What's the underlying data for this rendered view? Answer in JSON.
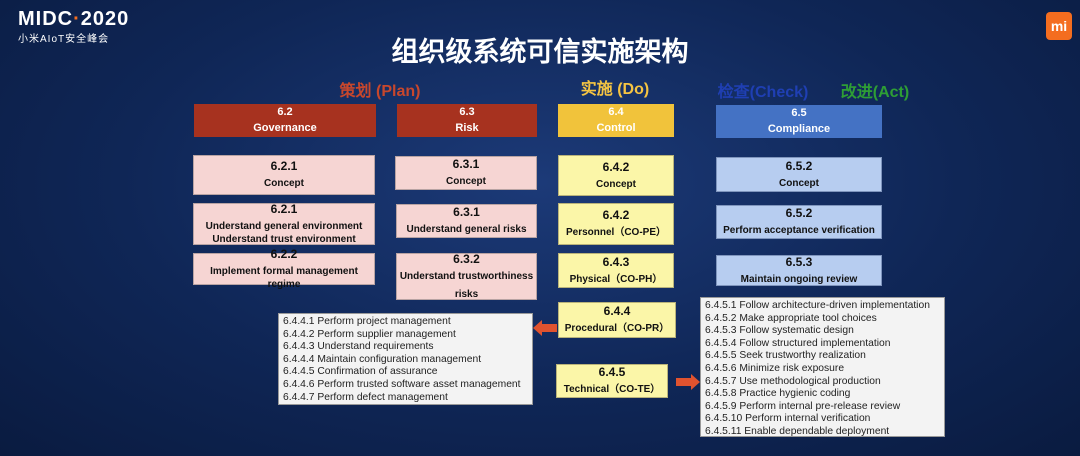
{
  "logo": {
    "main_left": "MIDC",
    "main_dot": "·",
    "main_right": "2020",
    "sub": "小米AIoT安全峰会",
    "mi": "mi"
  },
  "title": "组织级系统可信实施架构",
  "phases": {
    "plan": "策划 (Plan)",
    "do": "实施 (Do)",
    "check": "检查(Check)",
    "act": "改进(Act)"
  },
  "colors": {
    "plan_header": "#a7321f",
    "plan_box": "#f6d5d3",
    "do_header": "#f1c33b",
    "do_box": "#fbf6a8",
    "check_header": "#4472c4",
    "check_box": "#b7cdf0",
    "arrow": "#e0532f",
    "plan_text": "#c8472c",
    "do_text": "#f5c442",
    "check_text": "#1f3fb3",
    "act_text": "#2e9e35"
  },
  "headers": {
    "governance": {
      "num": "6.2",
      "label": "Governance"
    },
    "risk": {
      "num": "6.3",
      "label": "Risk"
    },
    "control": {
      "num": "6.4",
      "label": "Control"
    },
    "compliance": {
      "num": "6.5",
      "label": "Compliance"
    }
  },
  "governance": [
    {
      "num": "6.2.1",
      "text": "Concept"
    },
    {
      "num": "6.2.1",
      "text": "Understand general environment",
      "text2": "Understand trust environment"
    },
    {
      "num": "6.2.2",
      "text": "Implement formal management regime"
    }
  ],
  "risk": [
    {
      "num": "6.3.1",
      "text": "Concept"
    },
    {
      "num": "6.3.1",
      "text": "Understand general risks"
    },
    {
      "num": "6.3.2",
      "text": "Understand trustworthiness",
      "text2": "risks"
    }
  ],
  "control": [
    {
      "num": "6.4.2",
      "text": "Concept"
    },
    {
      "num": "6.4.2",
      "text": "Personnel（CO-PE）"
    },
    {
      "num": "6.4.3",
      "text": "Physical（CO-PH）"
    },
    {
      "num": "6.4.4",
      "text": "Procedural（CO-PR）"
    },
    {
      "num": "6.4.5",
      "text": "Technical（CO-TE）"
    }
  ],
  "compliance": [
    {
      "num": "6.5.2",
      "text": "Concept"
    },
    {
      "num": "6.5.2",
      "text": "Perform acceptance verification"
    },
    {
      "num": "6.5.3",
      "text": "Maintain ongoing review"
    }
  ],
  "procedural_list": [
    "6.4.4.1 Perform project management",
    "6.4.4.2 Perform supplier management",
    "6.4.4.3 Understand requirements",
    "6.4.4.4 Maintain configuration management",
    "6.4.4.5 Confirmation of assurance",
    "6.4.4.6 Perform trusted software asset management",
    "6.4.4.7 Perform defect management"
  ],
  "technical_list": [
    "6.4.5.1 Follow architecture-driven implementation",
    "6.4.5.2 Make appropriate tool choices",
    "6.4.5.3 Follow systematic design",
    "6.4.5.4 Follow structured implementation",
    "6.4.5.5 Seek trustworthy realization",
    "6.4.5.6 Minimize risk exposure",
    "6.4.5.7 Use methodological production",
    "6.4.5.8 Practice hygienic coding",
    "6.4.5.9 Perform internal pre-release review",
    "6.4.5.10 Perform internal verification",
    "6.4.5.11 Enable dependable deployment"
  ]
}
